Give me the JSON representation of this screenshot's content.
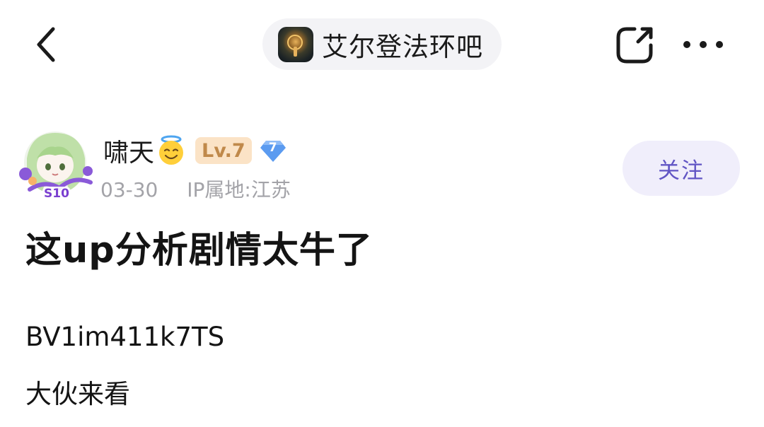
{
  "nav": {
    "forum_name": "艾尔登法环吧",
    "back_icon": "chevron-left-icon",
    "edit_icon": "edit-share-icon",
    "more_icon": "more-dots-icon"
  },
  "author": {
    "name": "啸天",
    "name_emoji": "smiling-face-with-halo",
    "level": "Lv.7",
    "diamond_level": "7",
    "date": "03-30",
    "ip_location": "IP属地:江苏",
    "avatar_badge": "S10"
  },
  "follow_button": {
    "label": "关注"
  },
  "post": {
    "title": "这up分析剧情太牛了",
    "lines": [
      "BV1im411k7TS",
      "大伙来看"
    ]
  },
  "colors": {
    "accent": "#6155c4",
    "follow_bg": "#f0eefb",
    "chip_bg": "#f3f3f6",
    "meta_text": "#a3a3a8",
    "level_badge_bg": "#fbe3c6",
    "level_badge_text": "#c0894a",
    "diamond": "#5b9bf0"
  }
}
